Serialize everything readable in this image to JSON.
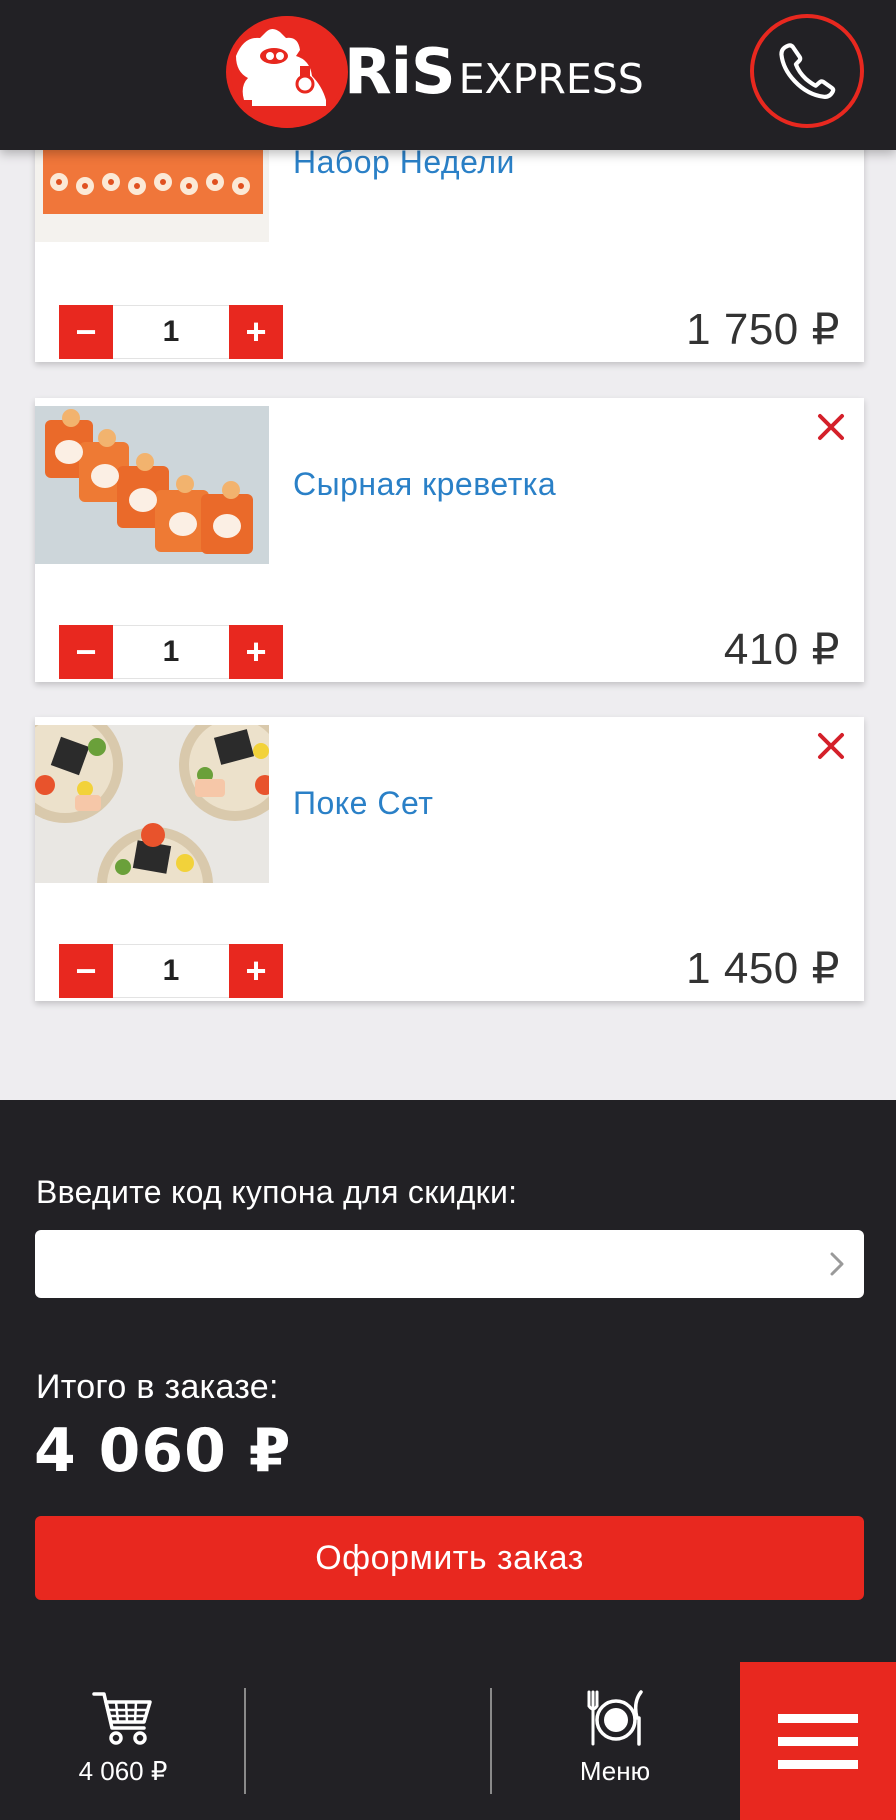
{
  "header": {
    "logo_main": "RiS",
    "logo_sub": "EXPRESS"
  },
  "cart_items": [
    {
      "title": "Набор Недели",
      "quantity": "1",
      "price": "1 750 ₽",
      "image_desc": "orange-sushi-rolls"
    },
    {
      "title": "Сырная креветка",
      "quantity": "1",
      "price": "410 ₽",
      "image_desc": "cheese-shrimp-rolls"
    },
    {
      "title": "Поке Сет",
      "quantity": "1",
      "price": "1 450 ₽",
      "image_desc": "poke-bowls"
    }
  ],
  "stepper": {
    "minus": "−",
    "plus": "+"
  },
  "coupon": {
    "label": "Введите код купона для скидки:",
    "placeholder": ""
  },
  "total": {
    "label": "Итого в заказе:",
    "value": "4 060 ₽"
  },
  "order_button": "Оформить заказ",
  "bottom_nav": {
    "cart_total": "4 060 ₽",
    "menu_label": "Меню"
  },
  "colors": {
    "accent": "#e8281f",
    "dark": "#222125",
    "link": "#2a80c7",
    "background": "#eeedf0"
  }
}
